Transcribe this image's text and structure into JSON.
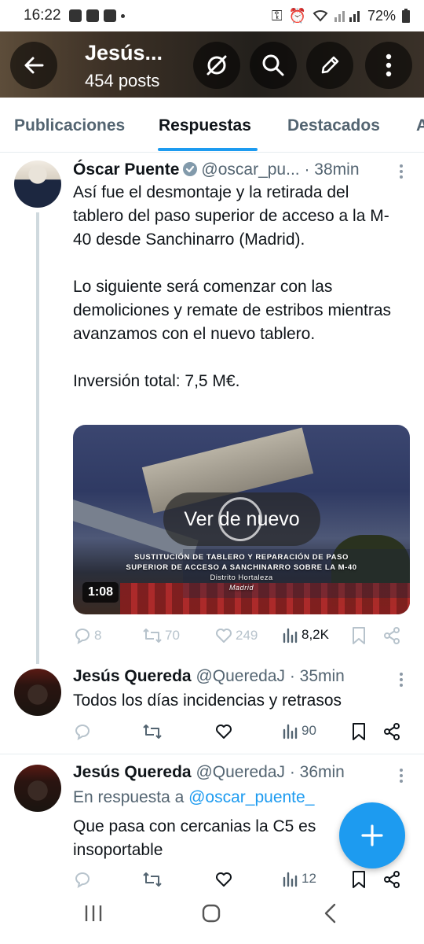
{
  "status_bar": {
    "time": "16:22",
    "battery": "72%"
  },
  "header": {
    "title": "Jesús...",
    "subtitle": "454 posts"
  },
  "tabs": [
    {
      "label": "Publicaciones"
    },
    {
      "label": "Respuestas"
    },
    {
      "label": "Destacados"
    },
    {
      "label": "A"
    }
  ],
  "tweets": [
    {
      "name": "Óscar Puente",
      "handle": "@oscar_pu...",
      "time": "· 38min",
      "text": "Así fue el desmontaje y la retirada del tablero del paso superior de acceso a la M-40 desde Sanchinarro (Madrid).\n\nLo siguiente será comenzar con las demoliciones y remate de estribos mientras avanzamos con el nuevo tablero.\n\nInversión total: 7,5 M€.",
      "media": {
        "replay_label": "Ver de nuevo",
        "duration": "1:08",
        "caption_line1": "SUSTITUCIÓN DE TABLERO Y REPARACIÓN DE PASO",
        "caption_line2": "SUPERIOR DE ACCESO A SANCHINARRO SOBRE LA M-40",
        "caption_district": "Distrito Hortaleza",
        "caption_city": "Madrid"
      },
      "stats": {
        "replies": "8",
        "reposts": "70",
        "likes": "249",
        "views": "8,2K"
      }
    },
    {
      "name": "Jesús Quereda",
      "handle": "@QueredaJ",
      "time": "· 35min",
      "text": "Todos los días incidencias y retrasos",
      "stats": {
        "views": "90"
      }
    },
    {
      "name": "Jesús Quereda",
      "handle": "@QueredaJ",
      "time": "· 36min",
      "reply_prefix": "En respuesta a",
      "reply_mention": "@oscar_puente_",
      "text": "Que pasa con cercanias la C5 es\ninsoportable",
      "stats": {
        "views": "12"
      }
    }
  ],
  "colors": {
    "accent": "#1d9bf0",
    "text": "#0f1419",
    "secondary": "#536471"
  }
}
